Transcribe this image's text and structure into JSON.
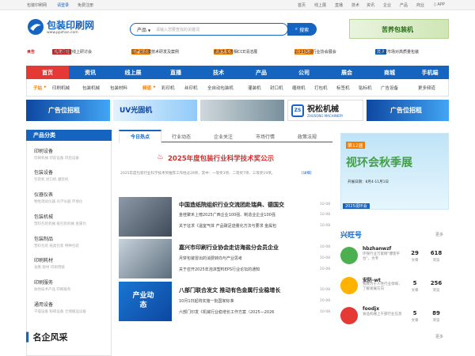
{
  "topbar": {
    "site": "包装印刷网",
    "login": "请登录",
    "register": "免费注册",
    "links": [
      "首页",
      "线上展",
      "直播",
      "技术",
      "资讯",
      "企业",
      "产品",
      "商业",
      "APP"
    ]
  },
  "logo": {
    "name": "包装印刷网",
    "url": "www.ppzhan.com"
  },
  "search": {
    "category": "产品",
    "placeholder": "请输入您要查找的关键词",
    "button": "搜索"
  },
  "header_ad": {
    "text": "苦荞包装机"
  },
  "ticker": {
    "label": "公告",
    "items": [
      {
        "tag": "热搜行业",
        "text": "锂电池回收线上研讨会"
      },
      {
        "tag": "专家观点",
        "text": "国产纳滤膜技术研发及案例"
      },
      {
        "tag": "新品发布",
        "text": "南京志恒亮相CCE清洁展"
      },
      {
        "tag": "线上观察",
        "text": "2023包装行业协会展会"
      },
      {
        "tag": "技术",
        "text": "为满足市场对高质量包装"
      }
    ]
  },
  "mainnav": [
    "首页",
    "资讯",
    "线上展",
    "直播",
    "技术",
    "产品",
    "公司",
    "展会",
    "商城",
    "手机端"
  ],
  "subnav": {
    "prefix1": "子站",
    "items1": [
      "印刷机械",
      "包装机械",
      "包装材料"
    ],
    "prefix2": "频道",
    "items2": [
      "彩印机",
      "丝印机",
      "全自动包装机",
      "灌装机",
      "封口机",
      "缠绕机",
      "打包机",
      "标签机",
      "贴标机",
      "广告设备"
    ],
    "more": "更多频道"
  },
  "banners": [
    "广告位招租",
    "UV光固机",
    "",
    "祝松机械",
    "广告位招租"
  ],
  "banner_sub": [
    "ZHUSONG MACHINERY"
  ],
  "categories": {
    "title": "产品分类",
    "items": [
      {
        "name": "印刷设备",
        "sub": "印刷机械 印前设备 印后设备"
      },
      {
        "name": "包装设备",
        "sub": "包装机 封口机 灌装机"
      },
      {
        "name": "仪器仪表",
        "sub": "物性测试仪器 光学仪器 环境仪"
      },
      {
        "name": "包装机械",
        "sub": "塑料包装机械 纸包装机械 金属包"
      },
      {
        "name": "包装制品",
        "sub": "塑料包装 纸类包装 特种包装"
      },
      {
        "name": "印刷耗材",
        "sub": "油墨 版材 印刷用纸"
      },
      {
        "name": "印刷服务",
        "sub": "防伪技术产品 印刷服务"
      },
      {
        "name": "通用设备",
        "sub": "干燥设备 粉碎设备 仓储搬运设备"
      }
    ]
  },
  "tabs": [
    "今日热点",
    "行业动态",
    "企业关注",
    "市场行情",
    "政策法规"
  ],
  "headline": {
    "title": "2025年度包装行业科学技术奖公示",
    "desc": "2025年度包装行业科学技术奖推荐工作经过29项，其中：一等奖3项、二等奖7项、三等奖19项。",
    "detail": "[详细]"
  },
  "news": [
    {
      "img": "",
      "title": "中国造纸院组织行业交流团赴瑞典、德国交",
      "date1": "10-08",
      "line1": "金桂聚禾上榜2025广西企业100强、制造业企业100强",
      "date2": "10-08",
      "line2": "关于征求《温室气体 产品碳足迹量化方法与要求 金属包",
      "date3": "10-08"
    },
    {
      "img": "",
      "title": "嘉兴市印刷行业协会走访海盐分会员企业",
      "date1": "10-08",
      "line1": "月饼包装冒出的消费转向与产业思考",
      "date2": "10-08",
      "line2": "关于召开2025年泡沫塑料EPS行业论坛的通知",
      "date3": "10-08"
    },
    {
      "img": "产业动态",
      "title": "八部门联合发文 推动有色金属行业稳增长",
      "date1": "10-08",
      "line1": "10月1日起将实施一批国家标准",
      "date2": "10-08",
      "line2": "六部门印发《机械行业稳增长工作方案（2025—2026",
      "date3": "10-08"
    }
  ],
  "right_ad": {
    "top": "第12届",
    "title": "视环会秋季展",
    "sub": "开展日期：8月4-11月1日",
    "badge": "2025视环会"
  },
  "xwh": {
    "title": "兴旺号",
    "more": "更多",
    "people": [
      {
        "name": "hbzhanwzf",
        "desc": "环保行业万家网\"爆客平台\"，为专",
        "n1": "29",
        "n2": "618",
        "l1": "文章",
        "l2": "浏览"
      },
      {
        "name": "安防-wt",
        "desc": "我致力于人性行业领域，了解发展方向",
        "n1": "5",
        "n2": "256",
        "l1": "文章",
        "l2": "浏览"
      },
      {
        "name": "foodjx",
        "desc": "食品机械上干部行业信息",
        "n1": "5",
        "n2": "89",
        "l1": "文章",
        "l2": "浏览"
      }
    ]
  },
  "mingqi": {
    "title": "名企风采",
    "more": "更多"
  },
  "colors": {
    "primary": "#1565c0",
    "red": "#d32f2f",
    "orange": "#f57c00"
  }
}
